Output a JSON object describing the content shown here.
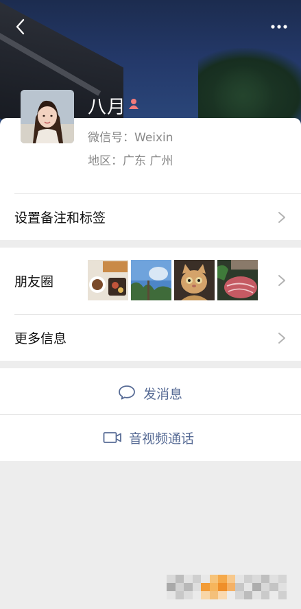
{
  "header": {
    "back_icon": "chevron-left-icon",
    "more_icon": "ellipsis-icon"
  },
  "profile": {
    "name": "八月",
    "gender_icon": "female-icon",
    "wechat_id_line": "微信号：Weixin",
    "region_line": "地区：广东 广州"
  },
  "rows": {
    "remark_label": "设置备注和标签",
    "moments_label": "朋友圈",
    "more_info_label": "更多信息"
  },
  "moments_photos": [
    {
      "name": "photo-food-table"
    },
    {
      "name": "photo-sky-trees"
    },
    {
      "name": "photo-cat"
    },
    {
      "name": "photo-meat"
    }
  ],
  "actions": {
    "message_label": "发消息",
    "message_icon": "chat-bubble-icon",
    "call_label": "音视频通话",
    "call_icon": "video-camera-icon"
  },
  "colors": {
    "accent": "#576b95",
    "background": "#ededed",
    "gender": "#f37b7b"
  }
}
